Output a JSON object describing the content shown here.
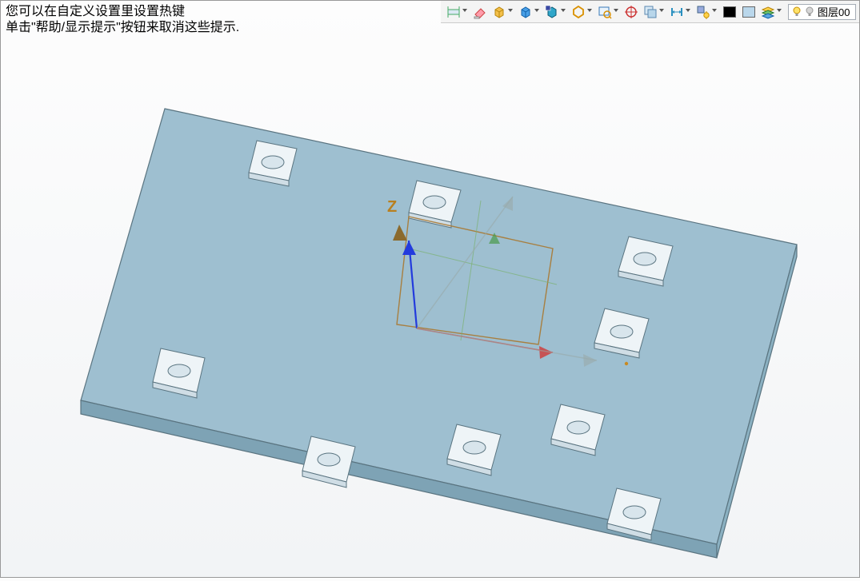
{
  "hint": {
    "line1": "您可以在自定义设置里设置热键",
    "line2": "单击\"帮助/显示提示\"按钮来取消这些提示."
  },
  "toolbar": {
    "icons": {
      "dim": "dimension-icon",
      "eraser": "eraser-icon",
      "box_yellow": "box-yellow-icon",
      "box_blue": "box-blue-icon",
      "box_teal": "box-teal-icon",
      "hex": "hexagon-icon",
      "zoom": "zoom-window-icon",
      "target": "target-icon",
      "planes": "planes-icon",
      "measure": "measure-icon",
      "light": "light-icon",
      "stack": "layer-stack-icon"
    },
    "swatch_black": "#000000",
    "swatch_light": "#bad7eb"
  },
  "layer": {
    "bulb": "bulb-icon",
    "label": "图层00"
  },
  "axis": {
    "z": "Z"
  }
}
